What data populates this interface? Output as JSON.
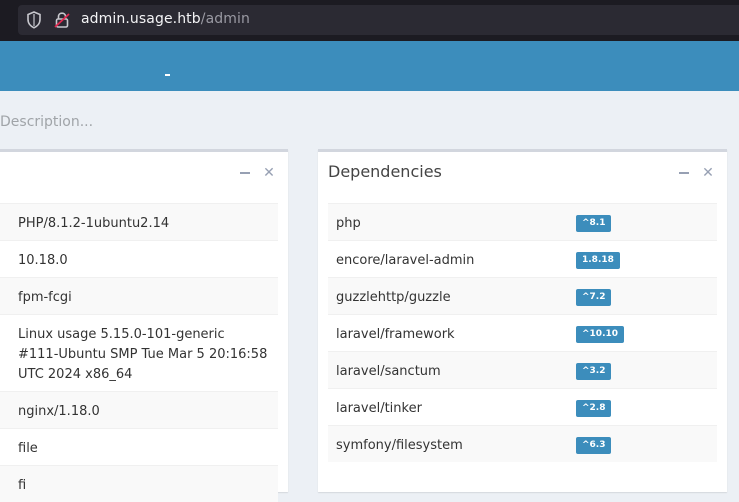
{
  "browser": {
    "url_host": "admin.usage.htb",
    "url_path": "/admin"
  },
  "page": {
    "description_placeholder": "Description..."
  },
  "environment_box": {
    "values": [
      "PHP/8.1.2-1ubuntu2.14",
      "10.18.0",
      "fpm-fcgi",
      "Linux usage 5.15.0-101-generic #111-Ubuntu SMP Tue Mar 5 20:16:58 UTC 2024 x86_64",
      "nginx/1.18.0",
      "file",
      "fi"
    ]
  },
  "dependencies_box": {
    "title": "Dependencies",
    "items": [
      {
        "name": "php",
        "version": "^8.1"
      },
      {
        "name": "encore/laravel-admin",
        "version": "1.8.18"
      },
      {
        "name": "guzzlehttp/guzzle",
        "version": "^7.2"
      },
      {
        "name": "laravel/framework",
        "version": "^10.10"
      },
      {
        "name": "laravel/sanctum",
        "version": "^3.2"
      },
      {
        "name": "laravel/tinker",
        "version": "^2.8"
      },
      {
        "name": "symfony/filesystem",
        "version": "^6.3"
      }
    ]
  },
  "colors": {
    "header": "#3c8dbc",
    "badge": "#3c8dbc",
    "browser_bg": "#1c1b22"
  }
}
